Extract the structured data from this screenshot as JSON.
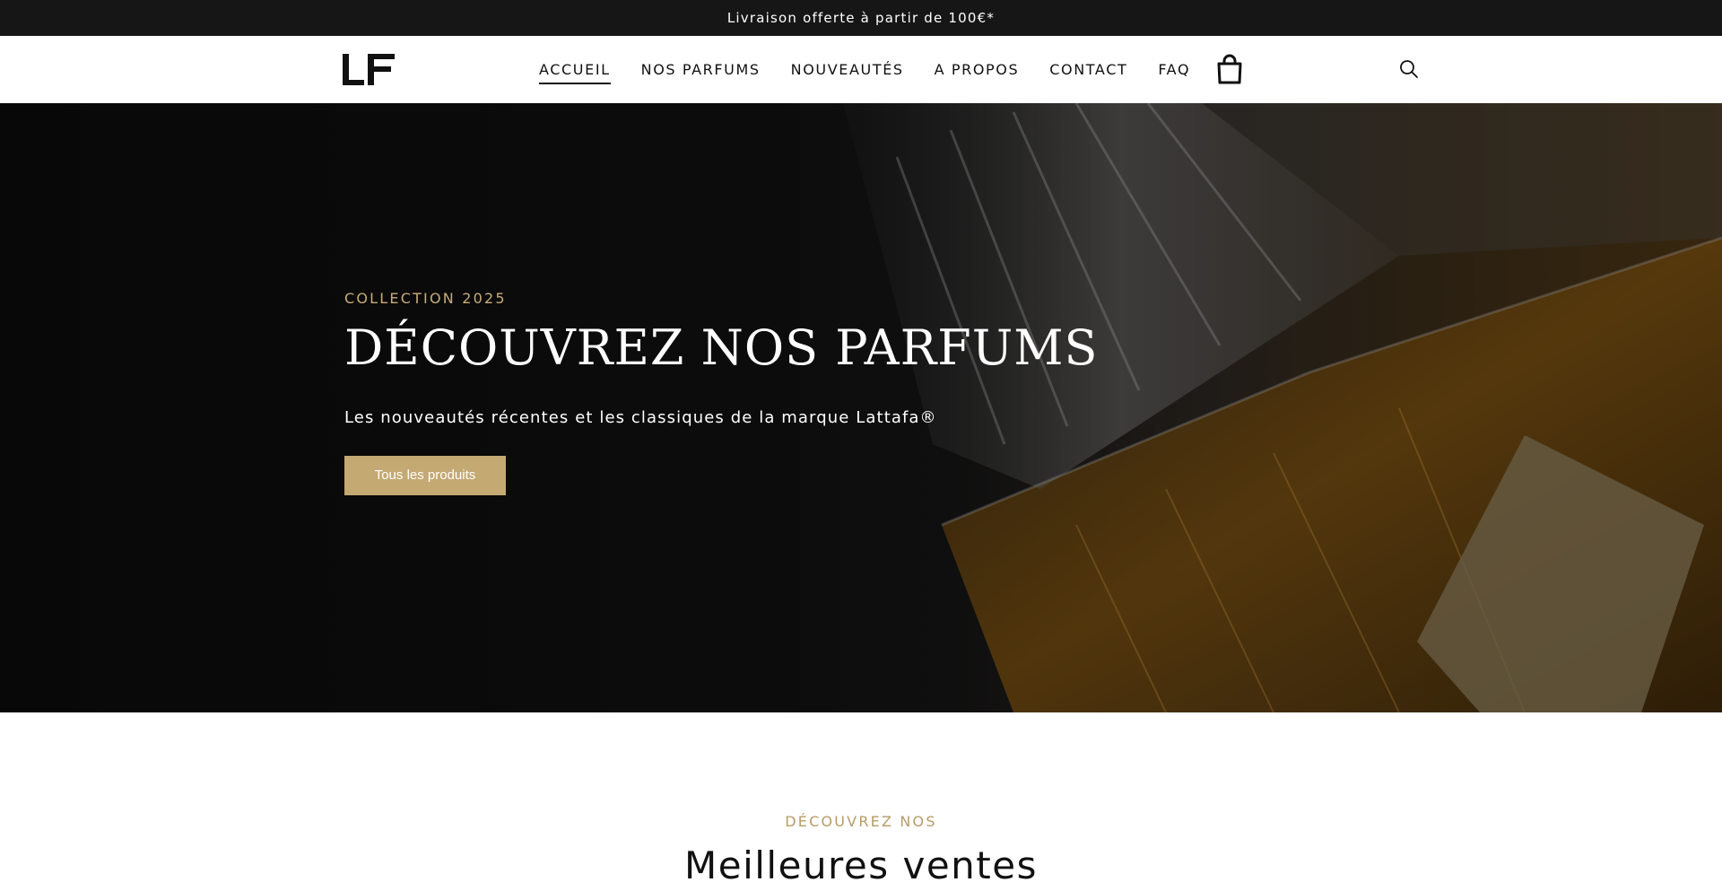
{
  "announcement": {
    "text": "Livraison offerte à partir de 100€*"
  },
  "header": {
    "logo_text": "LF",
    "nav": [
      {
        "label": "ACCUEIL",
        "active": true
      },
      {
        "label": "NOS PARFUMS",
        "active": false
      },
      {
        "label": "NOUVEAUTÉS",
        "active": false
      },
      {
        "label": "A PROPOS",
        "active": false
      },
      {
        "label": "CONTACT",
        "active": false
      },
      {
        "label": "FAQ",
        "active": false
      }
    ],
    "cart_icon": "shopping-bag-icon",
    "search_icon": "magnifier-icon"
  },
  "hero": {
    "eyebrow": "COLLECTION 2025",
    "title": "DÉCOUVREZ NOS PARFUMS",
    "subtitle": "Les nouveautés récentes et les classiques de la marque Lattafa®",
    "button_label": "Tous les produits"
  },
  "bestsellers": {
    "eyebrow": "DÉCOUVREZ NOS",
    "title": "Meilleures ventes"
  },
  "colors": {
    "announcement_bg": "#161616",
    "accent_gold": "#c4a972",
    "eyebrow_gold": "#c9ac78",
    "text_dark": "#111111"
  }
}
